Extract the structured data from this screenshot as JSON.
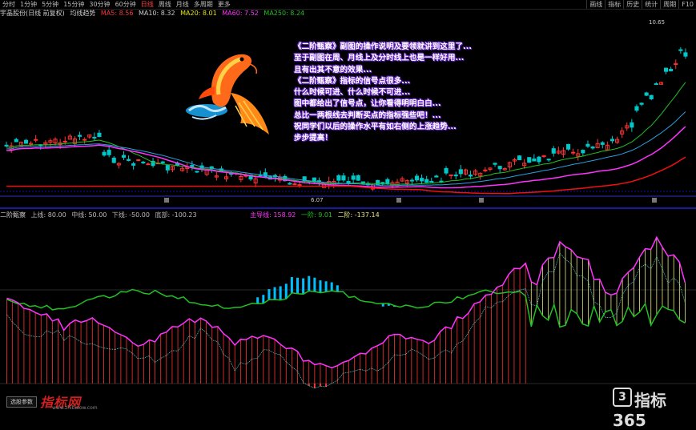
{
  "topbar": {
    "items": [
      "分时",
      "1分钟",
      "5分钟",
      "15分钟",
      "30分钟",
      "60分钟",
      "日线",
      "周线",
      "月线",
      "多周期",
      "更多"
    ],
    "active_index": 6,
    "right_items": [
      "画线",
      "指标",
      "历史",
      "统计",
      "周期",
      "F10"
    ]
  },
  "infobar": {
    "title": "宇晶股份(日线 前复权)",
    "indicator": "均线趋势",
    "values": [
      "MA5: 8.56",
      "MA10: 8.32",
      "MA20: 8.01",
      "MA60: 7.52",
      "MA250: 8.24"
    ]
  },
  "main": {
    "price_high": "10.65",
    "price_low": "6.07",
    "annotation_lines": [
      "《二阶甄察》副图的操作说明及要领就讲到这里了...",
      "至于副图在周、月线上及分时线上也是一样好用...",
      "且有出其不意的效果...",
      "《二阶甄察》指标的信号点很多...",
      "什么时候可进、什么时候不可进...",
      "图中都给出了信号点，让你看得明明白白...",
      "总比一两根线去判断买点的指标强些吧！...",
      "祝同学们以后的操作水平有如右侧的上涨趋势...",
      "步步提高！"
    ]
  },
  "sub": {
    "title": "二阶甄察",
    "values": [
      "上线: 80.00",
      "中线: 50.00",
      "下线: -50.00",
      "底部: -100.23",
      "主导线: 158.92",
      "一阶: 9.01",
      "二阶: -137.14"
    ]
  },
  "watermarks": {
    "left": "指标网",
    "left_url": "www.zhibiaow.com",
    "right": "指标365",
    "right_logo": "3",
    "button": "选股参数"
  },
  "colors": {
    "up": "#ff3333",
    "down": "#00c8c8",
    "ma_magenta": "#ff33ff",
    "ma_red": "#ee1111",
    "green": "#22c022",
    "yellow": "#e6e680",
    "cyan_fill": "#00bfff"
  }
}
